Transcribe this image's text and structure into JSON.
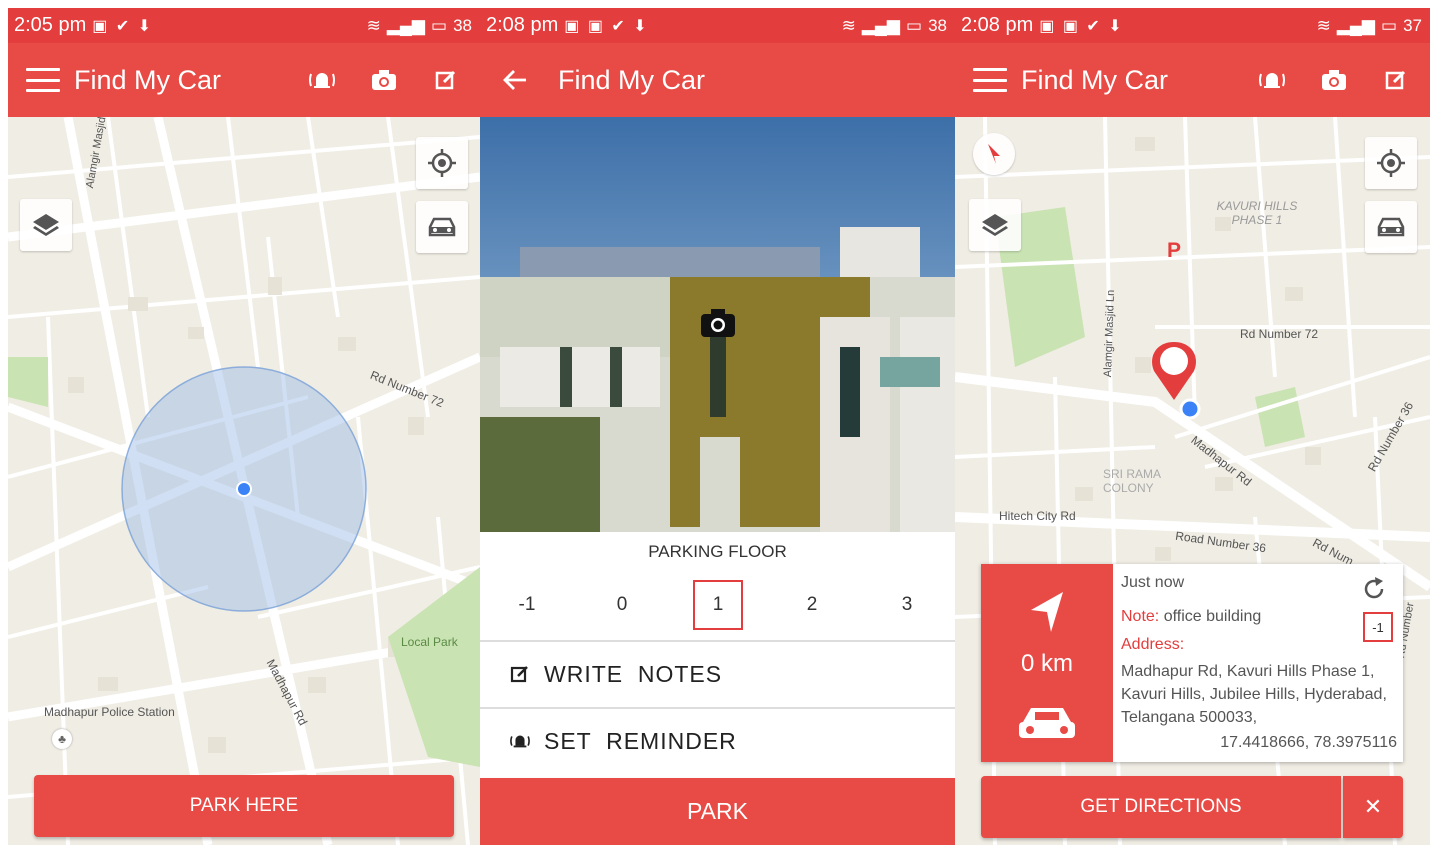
{
  "screens": [
    {
      "status": {
        "time": "2:05 pm",
        "battery": "38"
      },
      "appbar": {
        "title": "Find My Car"
      },
      "map_labels": {
        "street_a": "Alamgir Masjid Ln",
        "street_b": "Rd Number 72",
        "park": "Local Park",
        "police": "Madhapur Police Station",
        "road_c": "Madhapur Rd"
      },
      "bottom_button": "PARK HERE"
    },
    {
      "status": {
        "time": "2:08 pm",
        "battery": "38"
      },
      "appbar": {
        "title": "Find My Car"
      },
      "floor_label": "PARKING FLOOR",
      "floors": [
        "-1",
        "0",
        "1",
        "2",
        "3"
      ],
      "selected_floor": "1",
      "write_notes": "WRITE  NOTES",
      "set_reminder": "SET  REMINDER",
      "bottom_button": "PARK"
    },
    {
      "status": {
        "time": "2:08 pm",
        "battery": "37"
      },
      "appbar": {
        "title": "Find My Car"
      },
      "map_labels": {
        "area": "KAVURI HILLS PHASE 1",
        "rd72": "Rd Number 72",
        "masjid": "Alamgir Masjid Ln",
        "madhapur": "Madhapur Rd",
        "colony": "SRI RAMA COLONY",
        "hitech": "Hitech City Rd",
        "road36": "Road Number 36",
        "rdnum": "Rd Num",
        "rdnum36": "Rd Number 36",
        "rdnumber": "Rd Number"
      },
      "card": {
        "distance": "0 km",
        "when": "Just now",
        "note_label": "Note:",
        "note_value": " office building",
        "floor": "-1",
        "address_label": "Address:",
        "address": "Madhapur Rd, Kavuri Hills Phase 1, Kavuri Hills, Jubilee Hills, Hyderabad, Telangana 500033,",
        "coords": "17.4418666, 78.3975116"
      },
      "bottom_button": "GET DIRECTIONS",
      "close_glyph": "✕"
    }
  ],
  "colors": {
    "status": "#e33d3d",
    "appbar": "#e84a45",
    "map_bg": "#f0ede4",
    "road": "#ffffff",
    "accent_blue": "#3b82f6"
  }
}
